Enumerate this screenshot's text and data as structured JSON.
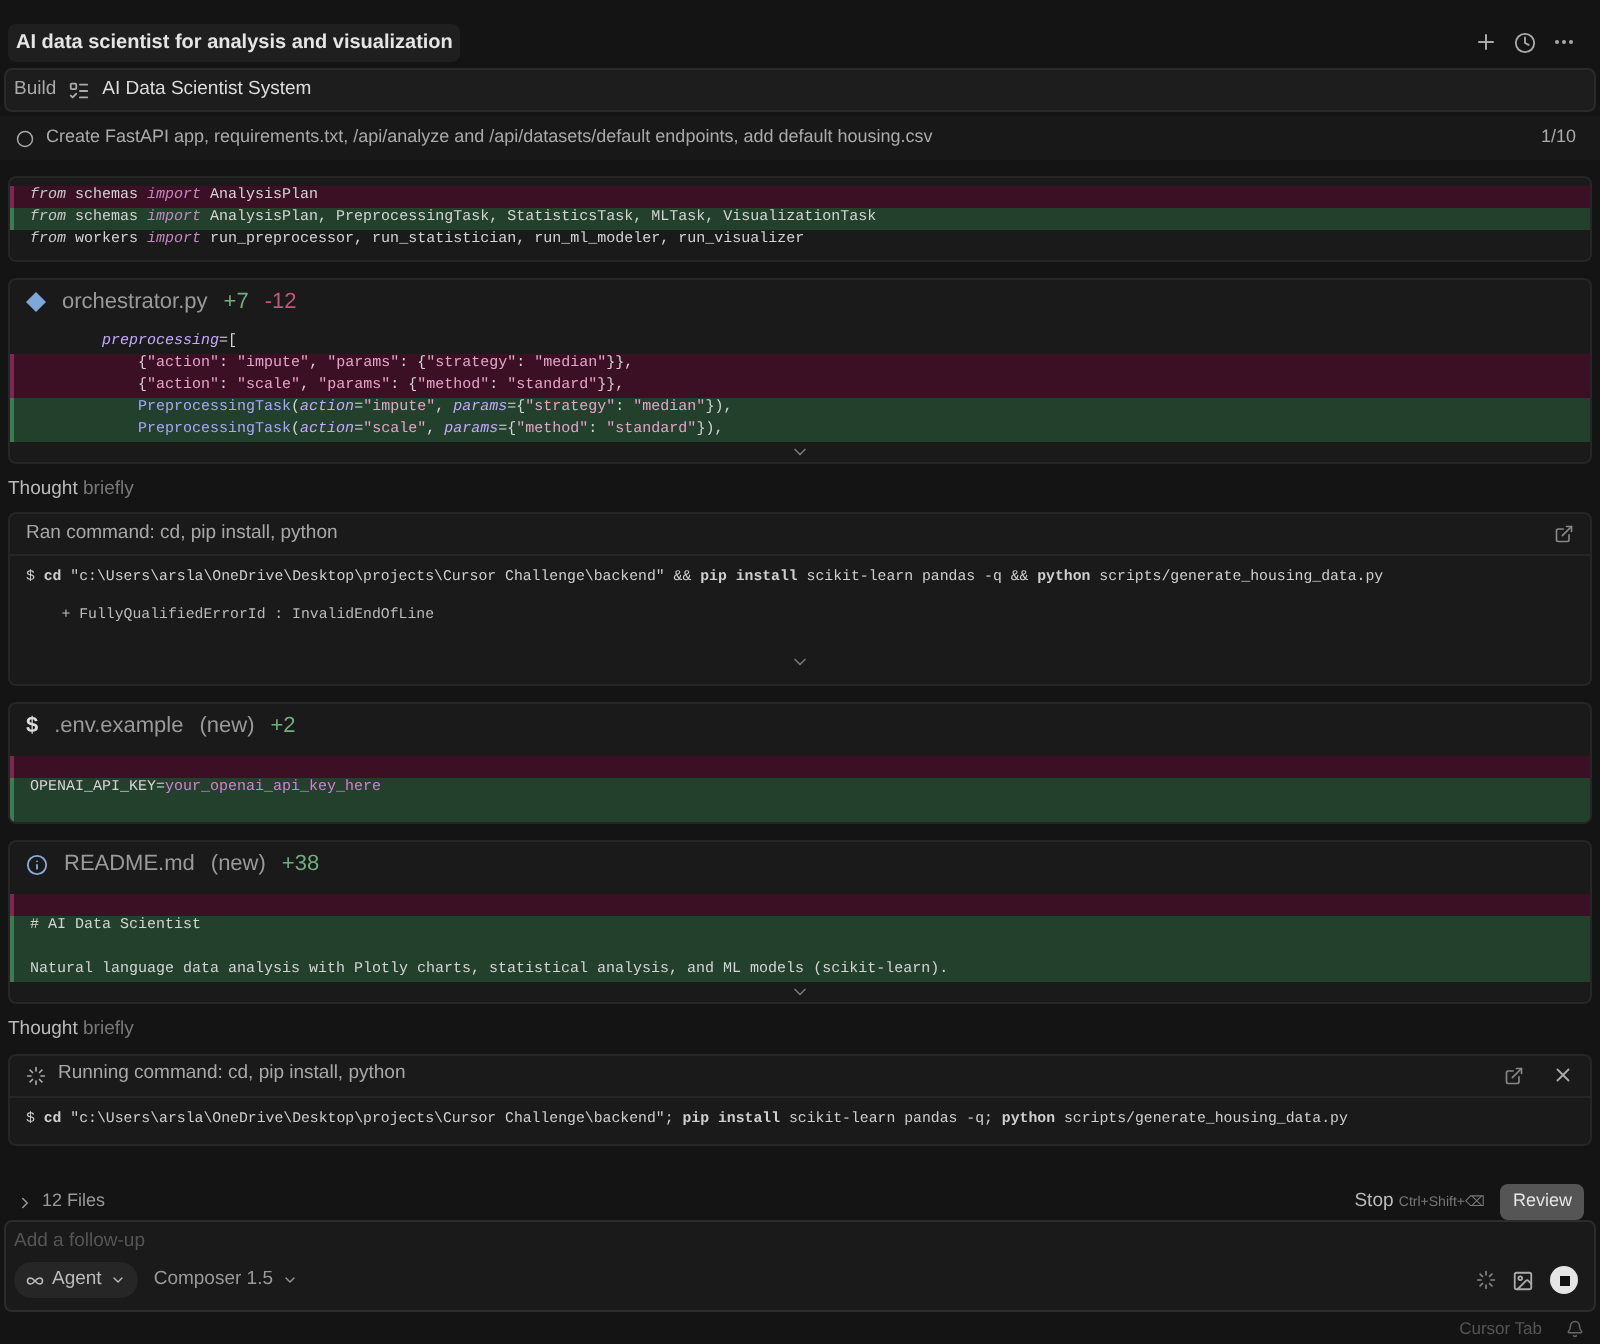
{
  "header": {
    "title": "AI data scientist for analysis and visualization"
  },
  "plan": {
    "mode": "Build",
    "name": "AI Data Scientist System"
  },
  "task": {
    "text": "Create FastAPI app, requirements.txt, /api/analyze and /api/datasets/default endpoints, add default housing.csv",
    "done": false,
    "progress": "1/10"
  },
  "blocks": [
    {
      "kind": "diff",
      "lines": [
        {
          "kind": "removed",
          "tokens": [
            {
              "text": "from",
              "kind": "keyword"
            },
            {
              "text": " schemas ",
              "kind": "plain"
            },
            {
              "text": "import",
              "kind": "import"
            },
            {
              "text": " AnalysisPlan",
              "kind": "plain"
            }
          ]
        },
        {
          "kind": "added",
          "tokens": [
            {
              "text": "from",
              "kind": "keyword"
            },
            {
              "text": " schemas ",
              "kind": "plain"
            },
            {
              "text": "import",
              "kind": "import"
            },
            {
              "text": " AnalysisPlan, PreprocessingTask, StatisticsTask, MLTask, VisualizationTask",
              "kind": "plain"
            }
          ]
        },
        {
          "kind": "context",
          "tokens": [
            {
              "text": "from",
              "kind": "keyword"
            },
            {
              "text": " workers ",
              "kind": "plain"
            },
            {
              "text": "import",
              "kind": "import"
            },
            {
              "text": " run_preprocessor, run_statistician, run_ml_modeler, run_visualizer",
              "kind": "plain"
            }
          ]
        }
      ]
    },
    {
      "kind": "diff",
      "file": {
        "kind": "python",
        "name": "orchestrator.py",
        "added": "+7",
        "removed": "-12"
      },
      "more": true,
      "lines": [
        {
          "kind": "context",
          "tokens": [
            {
              "text": "        preprocessing",
              "kind": "param"
            },
            {
              "text": "=[",
              "kind": "plain"
            }
          ]
        },
        {
          "kind": "removed",
          "tokens": [
            {
              "text": "            {",
              "kind": "plain"
            },
            {
              "text": "\"action\"",
              "kind": "string"
            },
            {
              "text": ": ",
              "kind": "plain"
            },
            {
              "text": "\"impute\"",
              "kind": "string"
            },
            {
              "text": ", ",
              "kind": "plain"
            },
            {
              "text": "\"params\"",
              "kind": "string"
            },
            {
              "text": ": {",
              "kind": "plain"
            },
            {
              "text": "\"strategy\"",
              "kind": "string"
            },
            {
              "text": ": ",
              "kind": "plain"
            },
            {
              "text": "\"median\"",
              "kind": "string"
            },
            {
              "text": "}},",
              "kind": "plain"
            }
          ]
        },
        {
          "kind": "removed",
          "tokens": [
            {
              "text": "            {",
              "kind": "plain"
            },
            {
              "text": "\"action\"",
              "kind": "string"
            },
            {
              "text": ": ",
              "kind": "plain"
            },
            {
              "text": "\"scale\"",
              "kind": "string"
            },
            {
              "text": ", ",
              "kind": "plain"
            },
            {
              "text": "\"params\"",
              "kind": "string"
            },
            {
              "text": ": {",
              "kind": "plain"
            },
            {
              "text": "\"method\"",
              "kind": "string"
            },
            {
              "text": ": ",
              "kind": "plain"
            },
            {
              "text": "\"standard\"",
              "kind": "string"
            },
            {
              "text": "}},",
              "kind": "plain"
            }
          ]
        },
        {
          "kind": "added",
          "tokens": [
            {
              "text": "            PreprocessingTask",
              "kind": "type"
            },
            {
              "text": "(",
              "kind": "plain"
            },
            {
              "text": "action",
              "kind": "param"
            },
            {
              "text": "=",
              "kind": "plain"
            },
            {
              "text": "\"impute\"",
              "kind": "string"
            },
            {
              "text": ", ",
              "kind": "plain"
            },
            {
              "text": "params",
              "kind": "param"
            },
            {
              "text": "={",
              "kind": "plain"
            },
            {
              "text": "\"strategy\"",
              "kind": "string"
            },
            {
              "text": ": ",
              "kind": "plain"
            },
            {
              "text": "\"median\"",
              "kind": "string"
            },
            {
              "text": "}),",
              "kind": "plain"
            }
          ]
        },
        {
          "kind": "added",
          "tokens": [
            {
              "text": "            PreprocessingTask",
              "kind": "type"
            },
            {
              "text": "(",
              "kind": "plain"
            },
            {
              "text": "action",
              "kind": "param"
            },
            {
              "text": "=",
              "kind": "plain"
            },
            {
              "text": "\"scale\"",
              "kind": "string"
            },
            {
              "text": ", ",
              "kind": "plain"
            },
            {
              "text": "params",
              "kind": "param"
            },
            {
              "text": "={",
              "kind": "plain"
            },
            {
              "text": "\"method\"",
              "kind": "string"
            },
            {
              "text": ": ",
              "kind": "plain"
            },
            {
              "text": "\"standard\"",
              "kind": "string"
            },
            {
              "text": "}),",
              "kind": "plain"
            }
          ]
        }
      ]
    },
    {
      "kind": "thought",
      "label": "Thought",
      "detail": "briefly"
    },
    {
      "kind": "command",
      "title": "Ran command: cd, pip install, python",
      "running": false,
      "command": "$ **cd** \"c:\\Users\\arsla\\OneDrive\\Desktop\\projects\\Cursor Challenge\\backend\" && **pip install** scikit-learn pandas -q && **python** scripts/generate_housing_data.py",
      "output": [
        "    + FullyQualifiedErrorId : InvalidEndOfLine"
      ],
      "more": true
    },
    {
      "kind": "diff",
      "file": {
        "kind": "glyph",
        "glyph": "$",
        "name": ".env.example",
        "tag": "(new)",
        "added": "+2"
      },
      "lines": [
        {
          "kind": "removed"
        },
        {
          "kind": "added",
          "tokens": [
            {
              "text": "OPENAI_API_KEY=",
              "kind": "plain"
            },
            {
              "text": "your_openai_api_key_here",
              "kind": "value"
            }
          ]
        },
        {
          "kind": "added"
        }
      ]
    },
    {
      "kind": "diff",
      "file": {
        "kind": "info",
        "name": "README.md",
        "tag": "(new)",
        "added": "+38"
      },
      "more": true,
      "lines": [
        {
          "kind": "removed"
        },
        {
          "kind": "added",
          "tokens": [
            {
              "text": "# AI Data Scientist",
              "kind": "plain"
            }
          ]
        },
        {
          "kind": "added"
        },
        {
          "kind": "added",
          "tokens": [
            {
              "text": "Natural language data analysis with Plotly charts, statistical analysis, and ML models (scikit-learn).",
              "kind": "plain"
            }
          ]
        }
      ]
    },
    {
      "kind": "thought",
      "label": "Thought",
      "detail": "briefly"
    },
    {
      "kind": "command",
      "title": "Running command: cd, pip install, python",
      "running": true,
      "command": "$ **cd** \"c:\\Users\\arsla\\OneDrive\\Desktop\\projects\\Cursor Challenge\\backend\"; **pip install** scikit-learn pandas -q; **python** scripts/generate_housing_data.py"
    }
  ],
  "files": {
    "label": "12 Files",
    "expanded": false
  },
  "stop": {
    "label": "Stop",
    "shortcut": "Ctrl+Shift+⌫"
  },
  "review": "Review",
  "composer": {
    "placeholder": "Add a follow-up",
    "mode": "Agent",
    "model": "Composer 1.5",
    "busy": true
  },
  "status": "Cursor Tab"
}
